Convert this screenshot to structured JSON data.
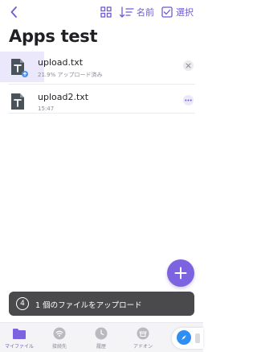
{
  "header": {
    "sort_label": "名前",
    "select_label": "選択"
  },
  "title": "Apps test",
  "files": [
    {
      "name": "upload.txt",
      "status": "21.9% アップロード済み",
      "progress": 0.219,
      "badge": "↑"
    },
    {
      "name": "upload2.txt",
      "status": "15:47"
    }
  ],
  "toast": {
    "count": "4",
    "text": "1 個のファイルをアップロード"
  },
  "tabs": [
    {
      "label": "マイファイル",
      "icon": "folder-icon",
      "active": true
    },
    {
      "label": "接続先",
      "icon": "wifi-icon",
      "active": false
    },
    {
      "label": "履歴",
      "icon": "clock-icon",
      "active": false
    },
    {
      "label": "アドオン",
      "icon": "store-icon",
      "active": false
    },
    {
      "label": "",
      "icon": "compass-icon",
      "active": false
    }
  ],
  "colors": {
    "accent": "#6e59d6",
    "fab": "#7e63e0",
    "toast_bg": "#4a4a4d",
    "progress_bg": "#ece8fb"
  }
}
